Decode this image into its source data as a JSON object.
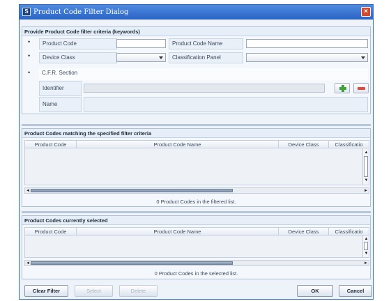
{
  "window": {
    "title": "Product Code Filter Dialog",
    "app_icon": "dialog-icon",
    "close_icon": "close-icon"
  },
  "criteria": {
    "title": "Provide Product Code filter criteria (keywords)",
    "product_code_label": "Product Code",
    "product_code_value": "",
    "product_code_name_label": "Product Code Name",
    "product_code_name_value": "",
    "device_class_label": "Device Class",
    "device_class_value": "",
    "classification_panel_label": "Classification Panel",
    "classification_panel_value": "",
    "cfr_section_label": "C.F.R. Section",
    "identifier_label": "Identifier",
    "identifier_value": "",
    "name_label": "Name",
    "bullet": "•"
  },
  "matching": {
    "title": "Product Codes matching the specified filter criteria",
    "columns": [
      "Product Code",
      "Product Code Name",
      "Device Class",
      "Classificatio"
    ],
    "rows": [],
    "status": "0 Product Codes in the filtered list."
  },
  "selected": {
    "title": "Product Codes currently selected",
    "columns": [
      "Product Code",
      "Product Code Name",
      "Device Class",
      "Classificatio"
    ],
    "rows": [],
    "status": "0 Product Codes in the selected list."
  },
  "buttons": {
    "clear_filter": "Clear Filter",
    "select": "Select",
    "delete": "Delete",
    "ok": "OK",
    "cancel": "Cancel"
  },
  "colors": {
    "titlebar": "#2a63c4",
    "add": "#3ea33a",
    "remove": "#e04a3a",
    "close": "#d9462c"
  }
}
